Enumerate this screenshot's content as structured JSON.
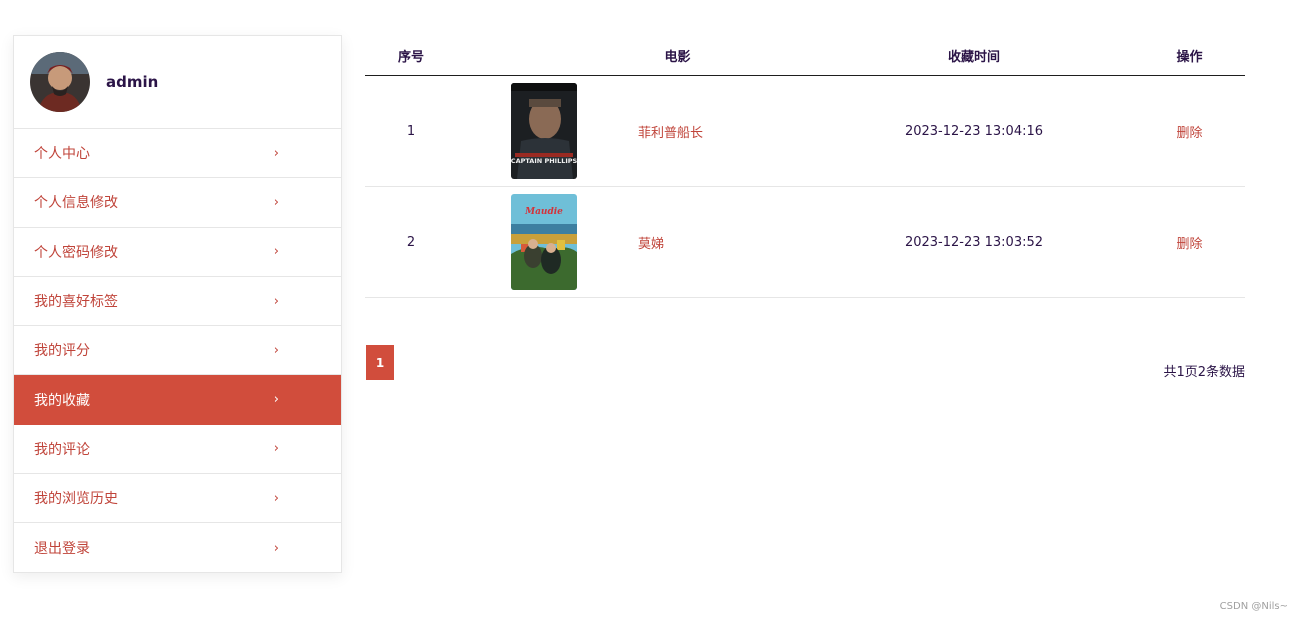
{
  "user": {
    "name": "admin"
  },
  "menu": {
    "items": [
      {
        "label": "个人中心"
      },
      {
        "label": "个人信息修改"
      },
      {
        "label": "个人密码修改"
      },
      {
        "label": "我的喜好标签"
      },
      {
        "label": "我的评分"
      },
      {
        "label": "我的收藏",
        "active": true
      },
      {
        "label": "我的评论"
      },
      {
        "label": "我的浏览历史"
      },
      {
        "label": "退出登录"
      }
    ]
  },
  "table": {
    "headers": {
      "index": "序号",
      "movie": "电影",
      "time": "收藏时间",
      "action": "操作"
    },
    "rows": [
      {
        "index": "1",
        "movie": "菲利普船长",
        "poster_text": "CAPTAIN PHILLIPS",
        "time": "2023-12-23 13:04:16",
        "action": "删除"
      },
      {
        "index": "2",
        "movie": "莫娣",
        "poster_text": "Maudie",
        "time": "2023-12-23 13:03:52",
        "action": "删除"
      }
    ]
  },
  "pagination": {
    "current": "1",
    "summary": "共1页2条数据"
  },
  "watermark": "CSDN @Nils~",
  "colors": {
    "accent": "#d14d3c",
    "link": "#c0443a",
    "text": "#2b1447"
  }
}
